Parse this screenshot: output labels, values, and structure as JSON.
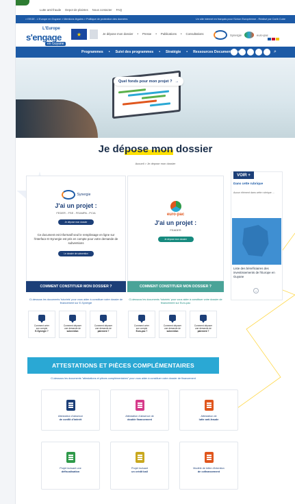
{
  "top_links": [
    "Lutte anti-fraude",
    "Depot de plaintes",
    "Nous contacter",
    "FAQ"
  ],
  "blue_bar": {
    "left": "> EEGE - L'Europe en Guyane > Mentions légales > Politique de protection des données",
    "right": "Un site internet en français pour l'Union Européenne - Réalisé par Carib Cube"
  },
  "brand": {
    "line1": "L'Europe",
    "line2": "s'engage",
    "line3": "en Guyane"
  },
  "sub_nav": [
    "Je dépose mon dossier",
    "Presse",
    "Publications",
    "Consultations"
  ],
  "synergie_label": "Synergie",
  "europac_small": "euro-pac",
  "main_nav": [
    "Programmes",
    "Suivi des programmes",
    "Stratégie",
    "Ressources Documentaires"
  ],
  "hero": {
    "question": "Quel fonds pour mon projet ?",
    "arrow": "→"
  },
  "page": {
    "title_a": "Je dé",
    "title_b": "pose mon",
    "title_c": " dossier"
  },
  "breadcrumb": "Accueil  >  Je dépose mon dossier",
  "col1": {
    "logo": "Synergie",
    "title": "J'ai un projet :",
    "sub": "FEDER - FSE - FEAMPA - PCIA",
    "button": "Je dépose mon dossier",
    "text": "Ce document est informatif seul le remplissage en ligne sur l'interface E-Synergie est pris en compte pour votre demande de subventions",
    "button2": "Le dossier de subvention",
    "band": "COMMENT CONSTITUER MON DOSSIER ?",
    "note": "Ci-dessous les documents 'tutoriels' pour vous aider à constituer votre dossier de financement sur E-Synergie",
    "minis": [
      [
        "Comment créer",
        "son compte",
        "E-Synergie ?"
      ],
      [
        "Comment déposer",
        "une demande de",
        "subvention"
      ],
      [
        "Comment déposer",
        "une demande de",
        "paiement ?"
      ]
    ]
  },
  "col2": {
    "logo": "euro-pac",
    "title": "J'ai un projet :",
    "sub": "FEADER",
    "button": "Je dépose mon dossier",
    "band": "COMMENT CONSTITUER MON DOSSIER ?",
    "note": "Ci-dessous les documents 'tutoriels' pour vous aider à constituer votre dossier de financement sur Euro-pac",
    "minis": [
      [
        "Comment créer",
        "son compte",
        "Euro-pac ?"
      ],
      [
        "Comment déposer",
        "une demande de",
        "subvention"
      ],
      [
        "Comment déposer",
        "une demande de",
        "paiement ?"
      ]
    ]
  },
  "aside": {
    "voir": "VOIR +",
    "title": "Dans cette rubrique",
    "empty": "Aucun élément dans cette rubrique ...",
    "map_text": "Liste des bénéficiaires des investissements de l'Europe en Guyane",
    "arrow": "›"
  },
  "attestations": {
    "title": "ATTESTATIONS ET PIÈCES COMPLÉMENTAIRES",
    "sub": "Ci-dessous les documents \"attestations et pièces complémentaires\" pour vous aider à constituer votre dossier de financement",
    "cards": [
      {
        "l1": "Attestation d'absence",
        "l2": "de conflit d'intérêt",
        "color": "#1c3f78"
      },
      {
        "l1": "Attestation d'absence de",
        "l2": "double financement",
        "color": "#d63a8a"
      },
      {
        "l1": "Attestation de",
        "l2": "lutte anti-fraude",
        "color": "#e0561d"
      },
      {
        "l1": "Projet incluant une",
        "l2": "défiscalisation",
        "color": "#2f9a4a"
      },
      {
        "l1": "Projet incluant",
        "l2": "un crédit bail",
        "color": "#c9a81f"
      },
      {
        "l1": "Modèle de lettre d'intention",
        "l2": "de cofinancement",
        "color": "#e0561d"
      }
    ]
  },
  "colors": {
    "navy": "#1c3f78",
    "blue": "#1c5aa6",
    "teal": "#168a7e",
    "cyan": "#2aa8d4",
    "highlight": "#ffe000"
  }
}
